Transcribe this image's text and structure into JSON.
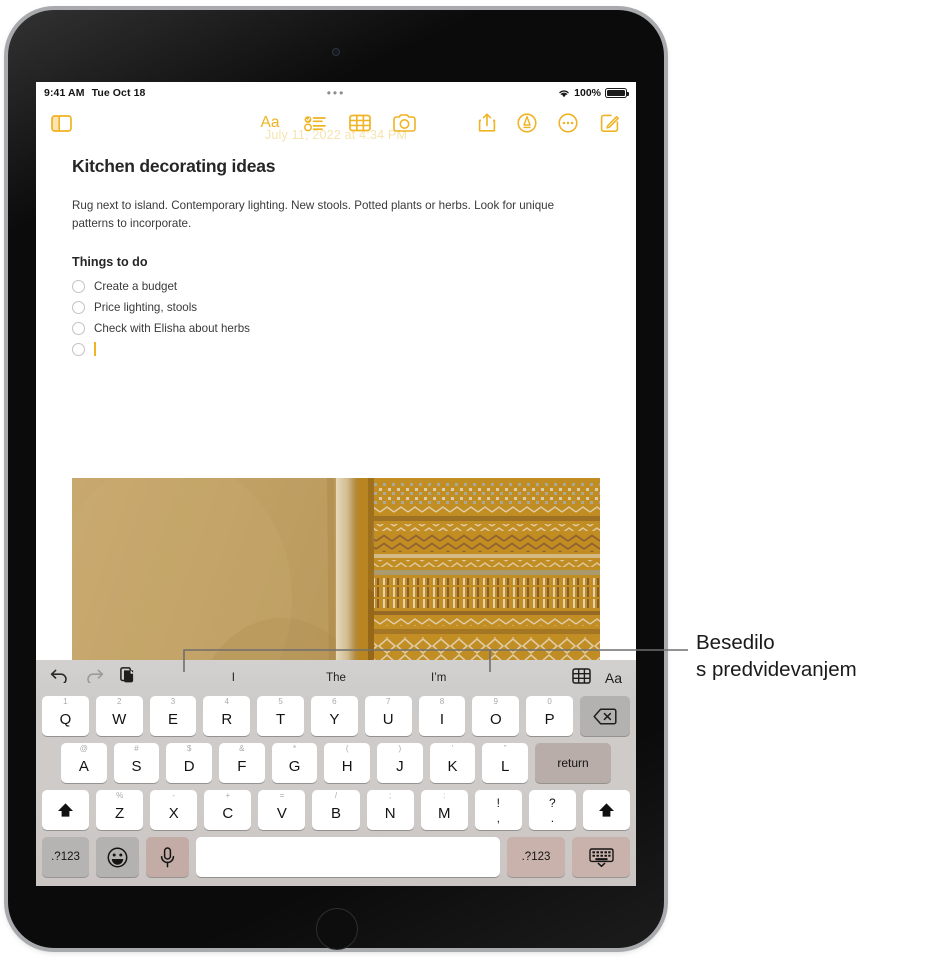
{
  "device": {
    "name": "ipad",
    "camera": "front-camera",
    "home_button": "home-button"
  },
  "status_bar": {
    "time": "9:41 AM",
    "date": "Tue Oct 18",
    "center_indicator": "•••",
    "wifi_icon": "wifi-icon",
    "battery_percent": "100%",
    "battery_icon": "battery-full-icon"
  },
  "toolbar": {
    "watermark": "July 11, 2022 at 4:34 PM",
    "sidebar_icon": "sidebar-icon",
    "format_label": "Aa",
    "checklist_icon": "checklist-icon",
    "table_icon": "table-icon",
    "camera_icon": "camera-icon",
    "share_icon": "share-icon",
    "markup_icon": "markup-icon",
    "more_icon": "more-ellipsis-icon",
    "compose_icon": "compose-icon"
  },
  "note": {
    "title": "Kitchen decorating ideas",
    "paragraph": "Rug next to island. Contemporary lighting. New stools. Potted plants or herbs. Look for unique patterns to incorporate.",
    "section_heading": "Things to do",
    "checklist": [
      {
        "label": "Create a budget",
        "checked": false
      },
      {
        "label": "Price lighting, stools",
        "checked": false
      },
      {
        "label": "Check with Elisha about herbs",
        "checked": false
      },
      {
        "label": "",
        "checked": false
      }
    ],
    "photo_alt": "kilim-rug-photo"
  },
  "shortcut_bar": {
    "undo_icon": "undo-icon",
    "redo_icon": "redo-icon",
    "paste_icon": "paste-icon",
    "table_icon": "table-icon",
    "format_label": "Aa",
    "predictions": [
      "I",
      "The",
      "I’m"
    ]
  },
  "keyboard": {
    "row1": [
      {
        "main": "Q",
        "alt": "1"
      },
      {
        "main": "W",
        "alt": "2"
      },
      {
        "main": "E",
        "alt": "3"
      },
      {
        "main": "R",
        "alt": "4"
      },
      {
        "main": "T",
        "alt": "5"
      },
      {
        "main": "Y",
        "alt": "6"
      },
      {
        "main": "U",
        "alt": "7"
      },
      {
        "main": "I",
        "alt": "8"
      },
      {
        "main": "O",
        "alt": "9"
      },
      {
        "main": "P",
        "alt": "0"
      }
    ],
    "backspace_icon": "backspace-icon",
    "row2": [
      {
        "main": "A",
        "alt": "@"
      },
      {
        "main": "S",
        "alt": "#"
      },
      {
        "main": "D",
        "alt": "$"
      },
      {
        "main": "F",
        "alt": "&"
      },
      {
        "main": "G",
        "alt": "*"
      },
      {
        "main": "H",
        "alt": "("
      },
      {
        "main": "J",
        "alt": ")"
      },
      {
        "main": "K",
        "alt": "’"
      },
      {
        "main": "L",
        "alt": "”"
      }
    ],
    "return_label": "return",
    "row3": [
      {
        "main": "Z",
        "alt": "%"
      },
      {
        "main": "X",
        "alt": "-"
      },
      {
        "main": "C",
        "alt": "+"
      },
      {
        "main": "V",
        "alt": "="
      },
      {
        "main": "B",
        "alt": "/"
      },
      {
        "main": "N",
        "alt": ";"
      },
      {
        "main": "M",
        "alt": ":"
      }
    ],
    "punct_keys": [
      {
        "top": "!",
        "bottom": ","
      },
      {
        "top": "?",
        "bottom": "."
      }
    ],
    "shift_left_icon": "shift-icon",
    "shift_right_icon": "shift-icon",
    "numeric_left_label": ".?123",
    "numeric_right_label": ".?123",
    "emoji_icon": "emoji-icon",
    "mic_icon": "microphone-icon",
    "space_label": "",
    "dismiss_icon": "hide-keyboard-icon"
  },
  "callout": {
    "line1": "Besedilo",
    "line2": "s predvidevanjem"
  },
  "colors": {
    "accent": "#efb323",
    "text": "#262626",
    "keyboard_bg": "#cfcbc8",
    "key_bg": "#ffffff",
    "callout_line": "#6e6e6e"
  }
}
